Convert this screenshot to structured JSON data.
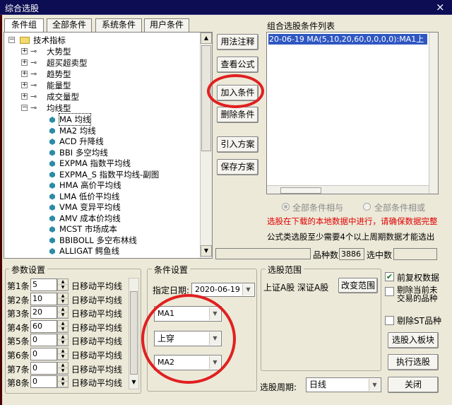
{
  "window": {
    "title": "综合选股",
    "close_symbol": "×"
  },
  "tabs": [
    "条件组",
    "全部条件",
    "系统条件",
    "用户条件"
  ],
  "tree": {
    "root": "技术指标",
    "groups": [
      "大势型",
      "超买超卖型",
      "趋势型",
      "能量型",
      "成交量型",
      "均线型"
    ],
    "items": [
      "MA 均线",
      "MA2 均线",
      "ACD 升降线",
      "BBI 多空均线",
      "EXPMA 指数平均线",
      "EXPMA_S 指数平均线-副图",
      "HMA 高价平均线",
      "LMA 低价平均线",
      "VMA 变异平均线",
      "AMV 成本价均线",
      "MCST 市场成本",
      "BBIBOLL 多空布林线",
      "ALLIGAT 鳄鱼线"
    ]
  },
  "actions": {
    "usage": "用法注释",
    "view_formula": "查看公式",
    "add_condition": "加入条件",
    "delete_condition": "删除条件",
    "import_plan": "引入方案",
    "save_plan": "保存方案"
  },
  "condition_list": {
    "label": "组合选股条件列表",
    "items": [
      "20-06-19 MA(5,10,20,60,0,0,0,0):MA1上"
    ]
  },
  "logic": {
    "and": "全部条件相与",
    "or": "全部条件相或"
  },
  "notice": {
    "warning": "选股在下载的本地数据中进行，请确保数据完整",
    "info": "公式类选股至少需要4个以上周期数据才能选出"
  },
  "stats": {
    "stock_count_label": "品种数",
    "stock_count_value": "3886",
    "selected_label": "选中数",
    "selected_value": ""
  },
  "params": {
    "legend": "参数设置",
    "rows": [
      {
        "label": "第1条",
        "value": "5",
        "suffix": "日移动平均线"
      },
      {
        "label": "第2条",
        "value": "10",
        "suffix": "日移动平均线"
      },
      {
        "label": "第3条",
        "value": "20",
        "suffix": "日移动平均线"
      },
      {
        "label": "第4条",
        "value": "60",
        "suffix": "日移动平均线"
      },
      {
        "label": "第5条",
        "value": "0",
        "suffix": "日移动平均线"
      },
      {
        "label": "第6条",
        "value": "0",
        "suffix": "日移动平均线"
      },
      {
        "label": "第7条",
        "value": "0",
        "suffix": "日移动平均线"
      },
      {
        "label": "第8条",
        "value": "0",
        "suffix": "日移动平均线"
      }
    ]
  },
  "conditions": {
    "legend": "条件设置",
    "date_label": "指定日期:",
    "date_value": "2020-06-19",
    "combo1": "MA1",
    "combo2": "上穿",
    "combo3": "MA2"
  },
  "scope": {
    "legend": "选股范围",
    "markets": "上证A股 深证A股",
    "change_button": "改变范围",
    "period_label": "选股周期:",
    "period_value": "日线"
  },
  "options": {
    "pre_adjust": "前复权数据",
    "exclude_suspended_line1": "剔除当前未",
    "exclude_suspended_line2": "交易的品种",
    "exclude_st": "剔除ST品种",
    "check_mark": "✔"
  },
  "bottom_buttons": {
    "to_board": "选股入板块",
    "run": "执行选股",
    "close": "关闭"
  },
  "icons": {
    "arrow_up": "▲",
    "arrow_down": "▼",
    "plus": "+",
    "minus": "−",
    "key": "⊸",
    "scroll_up": "▲",
    "scroll_down": "▼",
    "scroll_left": "◀",
    "scroll_right": "▶"
  },
  "colors": {
    "title_bar": "#0d0d54",
    "selection": "#2f57c2",
    "warning": "#e00000",
    "annotation_circle": "#e02020"
  }
}
